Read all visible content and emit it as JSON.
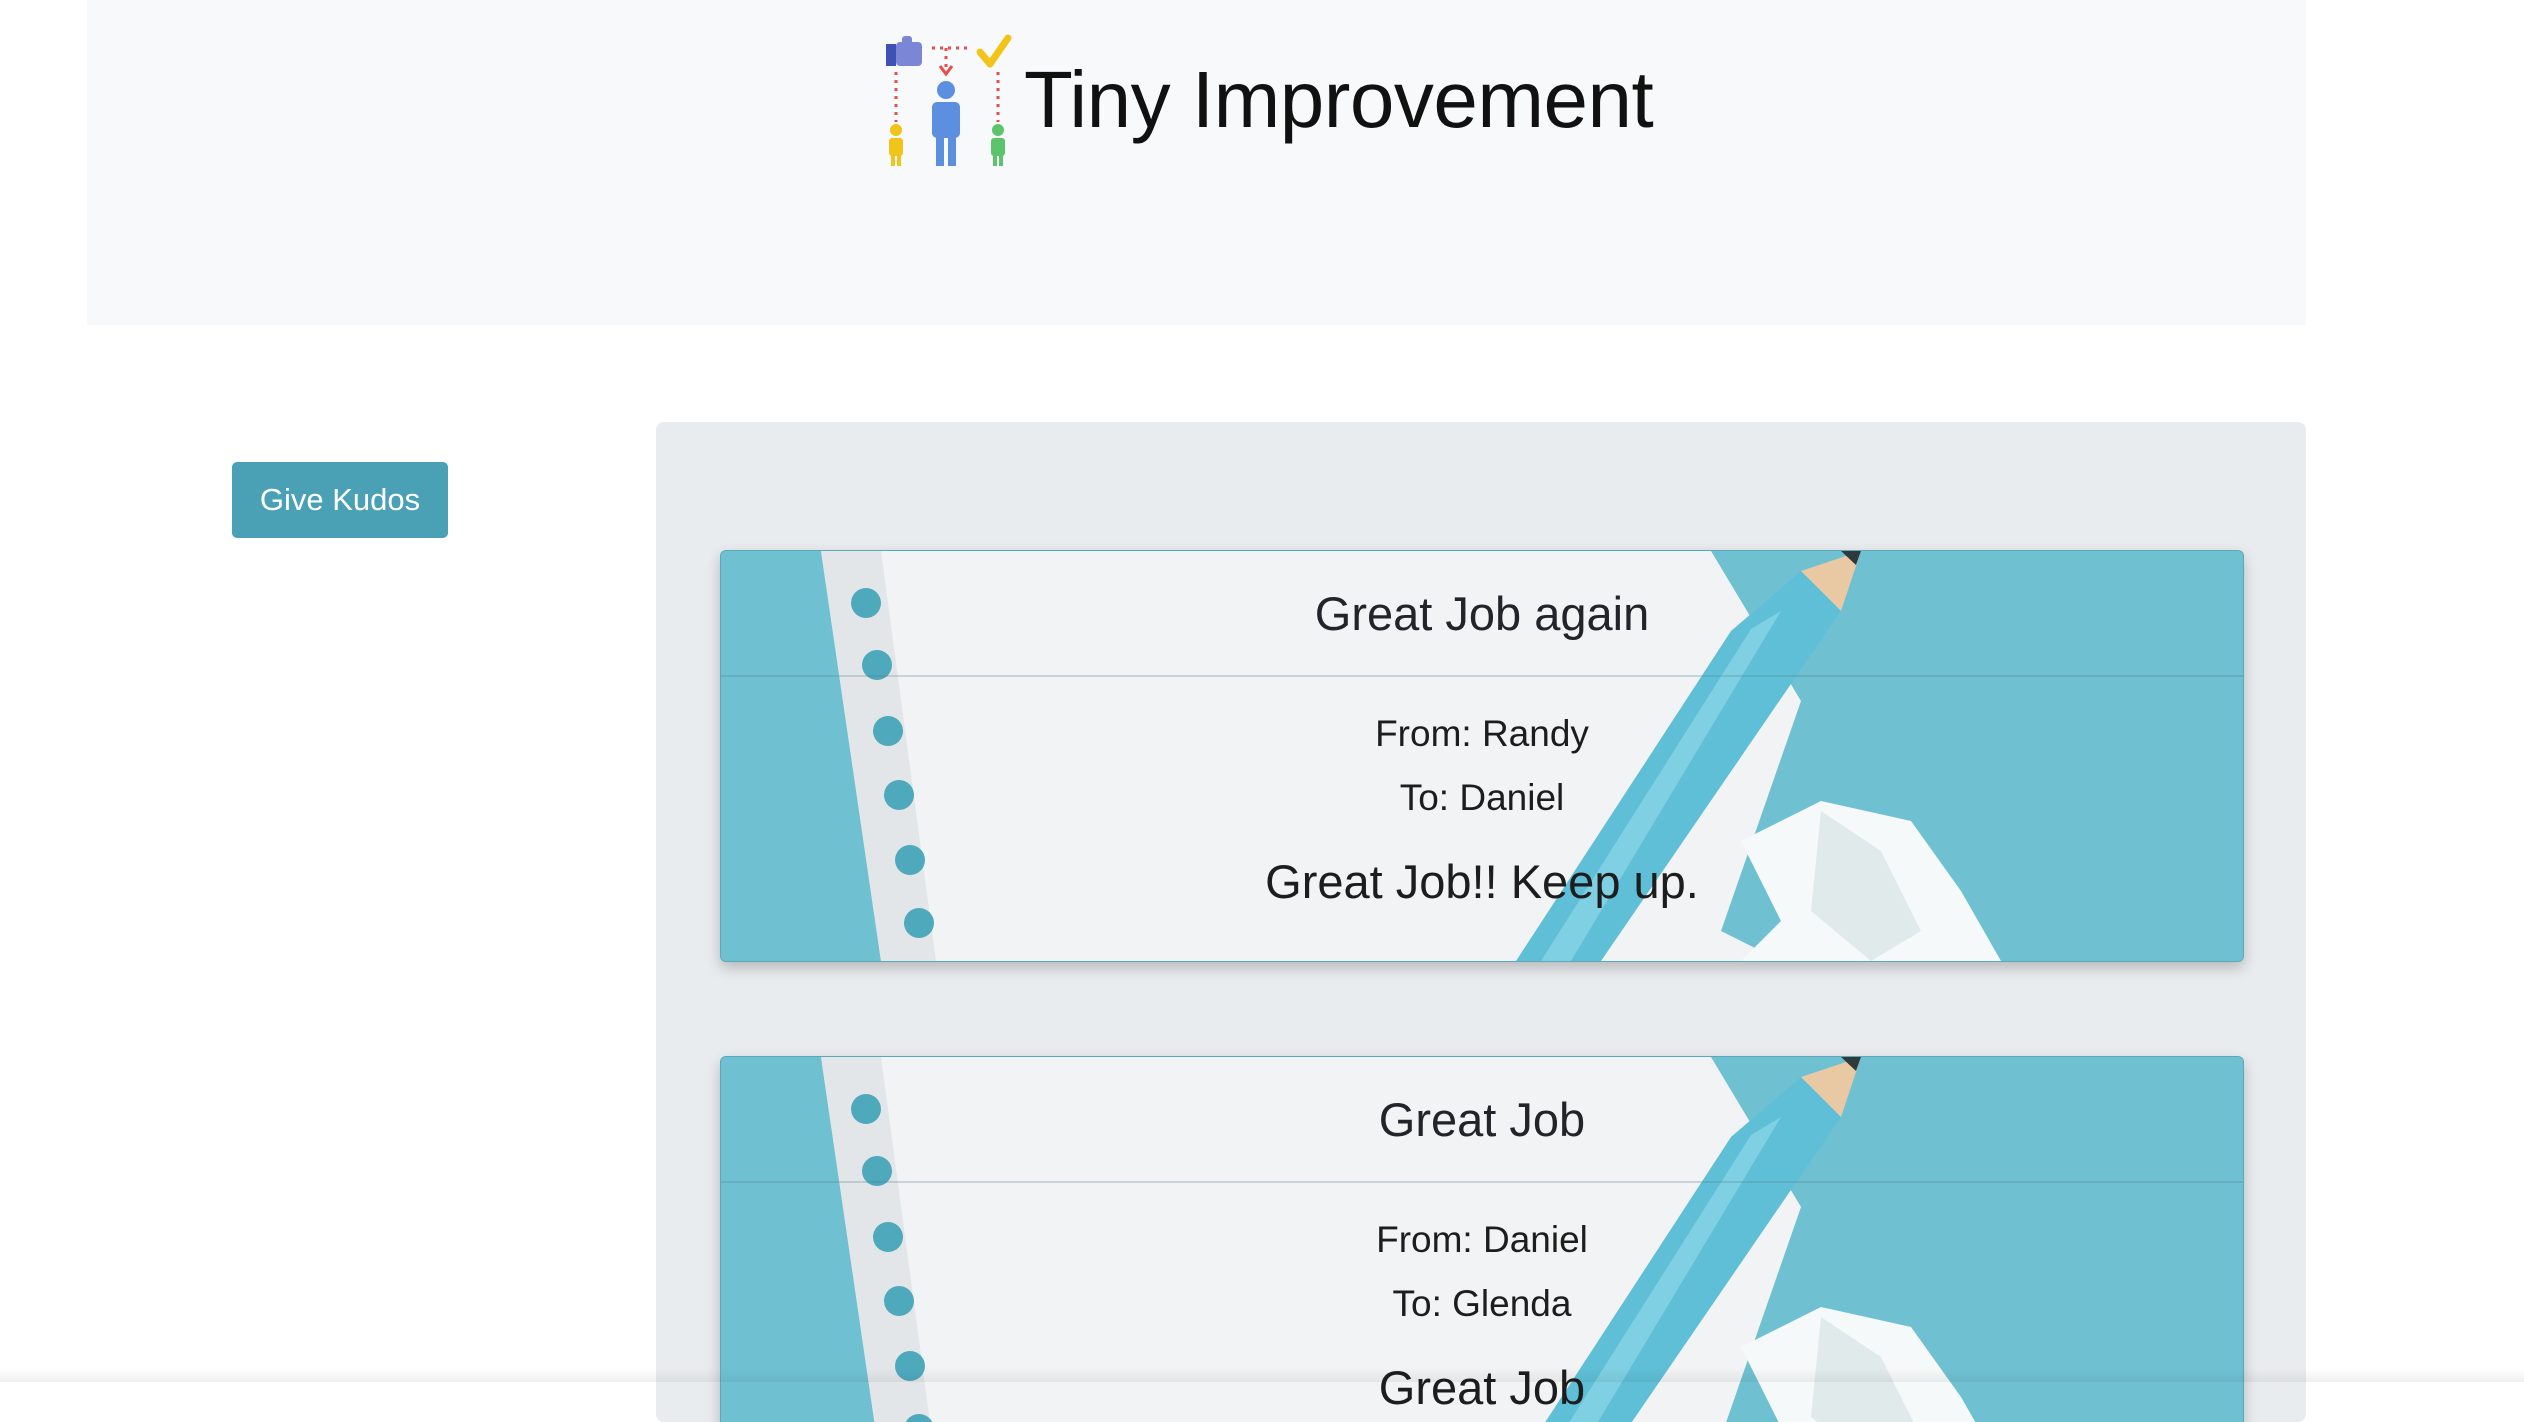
{
  "header": {
    "title": "Tiny Improvement",
    "logo_icon": "team-improvement-logo-icon"
  },
  "actions": {
    "give_kudos_label": "Give Kudos"
  },
  "kudos": [
    {
      "title": "Great Job again",
      "from": "From: Randy",
      "to": "To: Daniel",
      "message": "Great Job!! Keep up."
    },
    {
      "title": "Great Job",
      "from": "From: Daniel",
      "to": "To: Glenda",
      "message": "Great Job"
    }
  ],
  "colors": {
    "button": "#4aa0b5",
    "card_background": "#6fc1d2",
    "paper": "#f1f3f4",
    "pencil": "#5fbfd6",
    "feed_background": "#e9ecef",
    "header_background": "#f8f9fa"
  }
}
